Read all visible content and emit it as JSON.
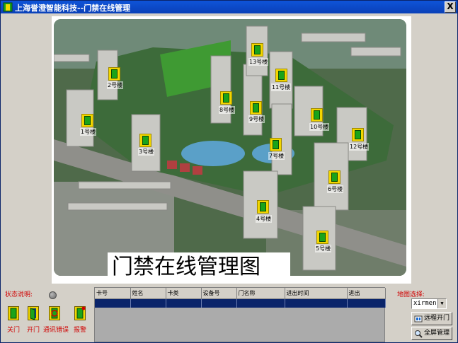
{
  "window": {
    "title": "上海誉澄智能科技--门禁在线管理",
    "close_label": "X"
  },
  "map": {
    "caption": "门禁在线管理图",
    "buildings": [
      {
        "id": 1,
        "label": "1号楼"
      },
      {
        "id": 2,
        "label": "2号楼"
      },
      {
        "id": 3,
        "label": "3号楼"
      },
      {
        "id": 4,
        "label": "4号楼"
      },
      {
        "id": 5,
        "label": "5号楼"
      },
      {
        "id": 6,
        "label": "6号楼"
      },
      {
        "id": 7,
        "label": "7号楼"
      },
      {
        "id": 8,
        "label": "8号楼"
      },
      {
        "id": 9,
        "label": "9号楼"
      },
      {
        "id": 10,
        "label": "10号楼"
      },
      {
        "id": 11,
        "label": "11号楼"
      },
      {
        "id": 12,
        "label": "12号楼"
      },
      {
        "id": 13,
        "label": "13号楼"
      }
    ]
  },
  "status": {
    "title": "状态说明:",
    "legend": [
      "关门",
      "开门",
      "通讯错误",
      "报警"
    ]
  },
  "grid": {
    "columns": [
      "卡号",
      "姓名",
      "卡类",
      "设备号",
      "门名称",
      "进出时间",
      "进出"
    ]
  },
  "map_select": {
    "label": "地图选择:",
    "value": "xirmen",
    "remote_open_label": "远程开门",
    "fullscreen_label": "全屏管理"
  },
  "colors": {
    "titlebar": "#0a40b8",
    "status_text": "#d00000",
    "selected_row": "#0a246a",
    "marker_yellow": "#f2d600",
    "door_green": "#1aa31a"
  }
}
